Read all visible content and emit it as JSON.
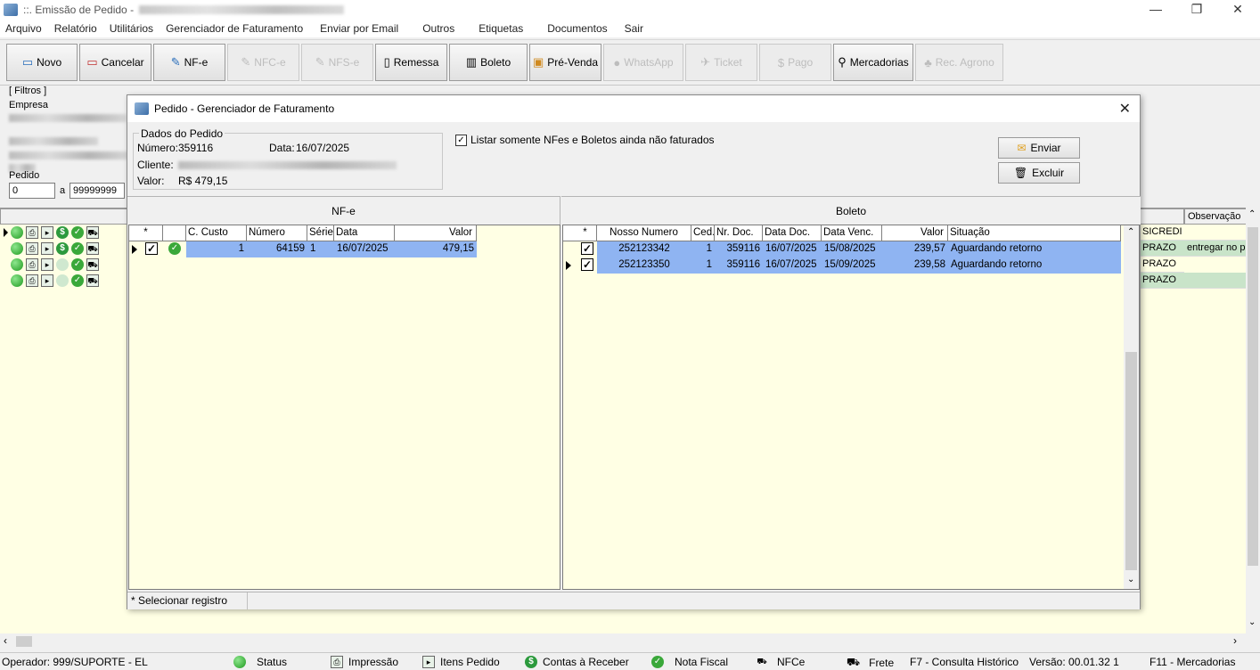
{
  "window": {
    "title": "::. Emissão de Pedido -",
    "minimize": "—",
    "maximize": "❐",
    "close": "✕"
  },
  "menu": [
    "Arquivo",
    "Relatório",
    "Utilitários",
    "Gerenciador de Faturamento",
    "Enviar por Email",
    "Outros",
    "Etiquetas",
    "Documentos",
    "Sair"
  ],
  "toolbar": {
    "novo": "Novo",
    "cancelar": "Cancelar",
    "nfe": "NF-e",
    "nfce": "NFC-e",
    "nfse": "NFS-e",
    "remessa": "Remessa",
    "boleto": "Boleto",
    "prevenda": "Pré-Venda",
    "whatsapp": "WhatsApp",
    "ticket": "Ticket",
    "pago": "Pago",
    "mercadorias": "Mercadorias",
    "recagrono": "Rec. Agrono"
  },
  "filters": {
    "title": "[ Filtros ]",
    "empresa": "Empresa",
    "pedido": "Pedido",
    "from": "0",
    "sep": "a",
    "to": "99999999"
  },
  "bg_grid": {
    "observacao_header": "Observação",
    "rows": [
      {
        "cond": "SICREDI",
        "obs": ""
      },
      {
        "cond": "PRAZO",
        "obs": "entregar no p"
      },
      {
        "cond": "PRAZO",
        "obs": ""
      },
      {
        "cond": "PRAZO",
        "obs": ""
      }
    ]
  },
  "dialog": {
    "title": "Pedido - Gerenciador de Faturamento",
    "close": "✕",
    "dados": {
      "legend": "Dados do Pedido",
      "numero_label": "Número:",
      "numero": "359116",
      "data_label": "Data:",
      "data": "16/07/2025",
      "cliente_label": "Cliente:",
      "valor_label": "Valor:",
      "valor": "R$ 479,15"
    },
    "filter_checkbox": "Listar somente NFes e Boletos ainda não faturados",
    "enviar": "Enviar",
    "excluir": "Excluir",
    "nfe": {
      "title": "NF-e",
      "headers": [
        "*",
        "",
        "C. Custo",
        "Número",
        "Série",
        "Data",
        "Valor"
      ],
      "rows": [
        {
          "ccusto": "1",
          "numero": "64159",
          "serie": "1",
          "data": "16/07/2025",
          "valor": "479,15"
        }
      ]
    },
    "boleto": {
      "title": "Boleto",
      "headers": [
        "*",
        "Nosso Numero",
        "Ced.",
        "Nr. Doc.",
        "Data Doc.",
        "Data Venc.",
        "Valor",
        "Situação"
      ],
      "rows": [
        {
          "nosso": "252123342",
          "ced": "1",
          "nrdoc": "359116",
          "datadoc": "16/07/2025",
          "venc": "15/08/2025",
          "valor": "239,57",
          "situacao": "Aguardando retorno"
        },
        {
          "nosso": "252123350",
          "ced": "1",
          "nrdoc": "359116",
          "datadoc": "16/07/2025",
          "venc": "15/09/2025",
          "valor": "239,58",
          "situacao": "Aguardando retorno"
        }
      ]
    },
    "status": "* Selecionar registro"
  },
  "statusbar": {
    "operador": "Operador: 999/SUPORTE - EL",
    "status": "Status",
    "impressao": "Impressão",
    "itens": "Itens Pedido",
    "contas": "Contas à Receber",
    "nota": "Nota Fiscal",
    "nfce": "NFCe",
    "frete": "Frete",
    "f7": "F7 - Consulta Histórico",
    "versao": "Versão: 00.01.32 1",
    "f11": "F11 - Mercadorias"
  },
  "colors": {
    "selection": "#8fb4f2",
    "grid_bg": "#ffffe4",
    "green": "#1f9a1f"
  }
}
